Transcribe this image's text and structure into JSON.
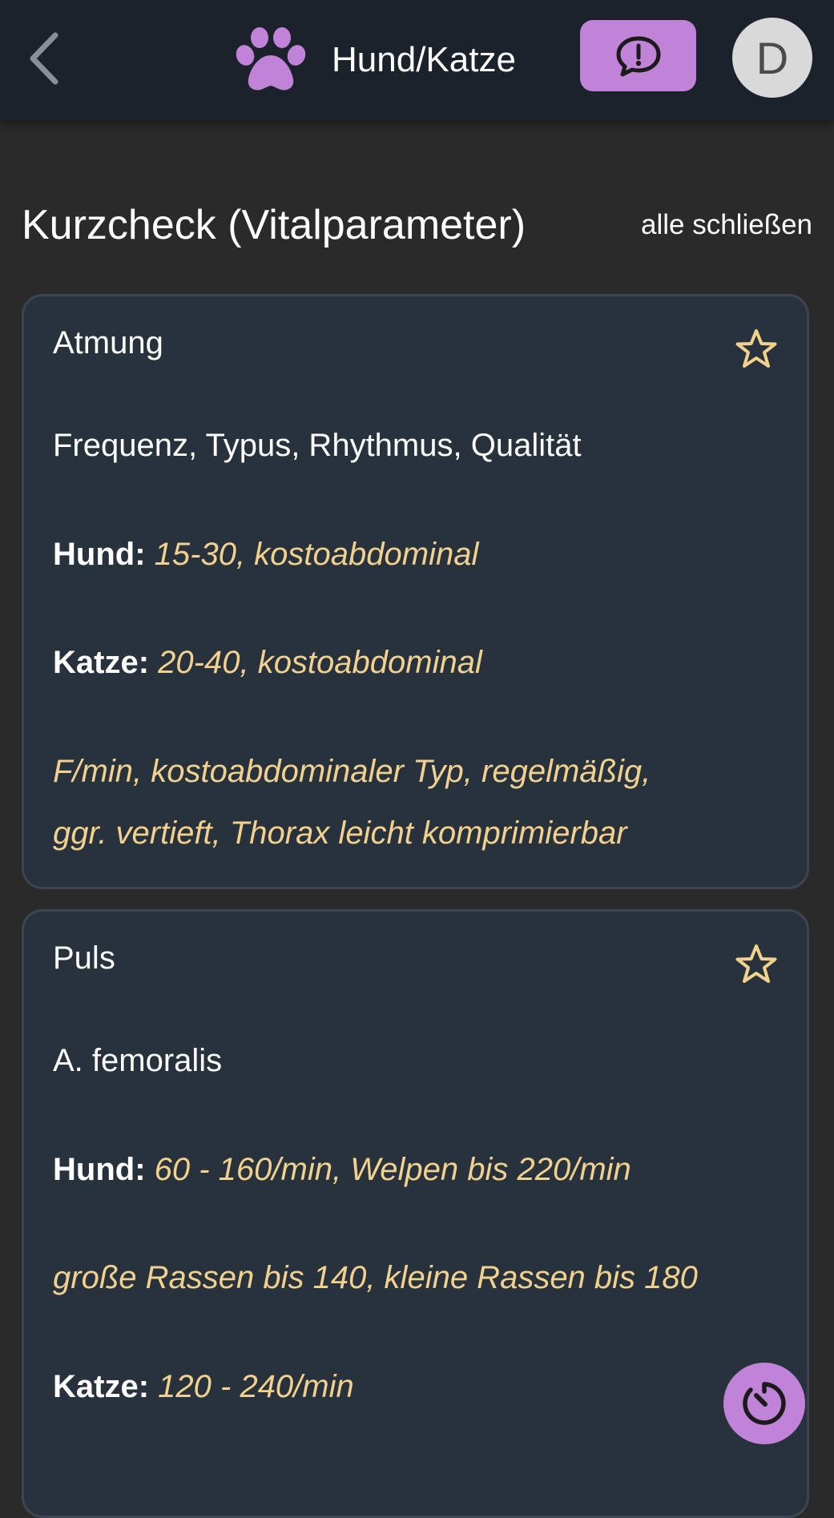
{
  "app_bar": {
    "title": "Hund/Katze",
    "back_icon": "chevron-left-icon",
    "logo_icon": "paw-icon",
    "feedback_icon": "speech-bubble-exclamation-icon",
    "avatar_initial": "D",
    "accent_color": "#c083d8"
  },
  "section": {
    "title": "Kurzcheck (Vitalparameter)",
    "close_all_label": "alle schließen"
  },
  "cards": [
    {
      "title": "Atmung",
      "favorite_icon": "star-outline-icon",
      "description": "Frequenz, Typus, Rhythmus, Qualität",
      "entries": [
        {
          "label": "Hund:",
          "value": "15-30, kostoabdominal"
        },
        {
          "label": "Katze:",
          "value": "20-40, kostoabdominal"
        }
      ],
      "note_lines": [
        "F/min, kostoabdominaler Typ, regelmäßig,",
        "ggr. vertieft, Thorax leicht komprimierbar"
      ]
    },
    {
      "title": "Puls",
      "favorite_icon": "star-outline-icon",
      "description": "A. femoralis",
      "entries": [
        {
          "label": "Hund:",
          "value": "60 - 160/min, Welpen bis 220/min"
        }
      ],
      "note_lines": [
        "große Rassen bis 140, kleine Rassen bis 180"
      ],
      "entries_after": [
        {
          "label": "Katze:",
          "value": "120 - 240/min"
        }
      ]
    }
  ],
  "fab": {
    "icon": "timer-icon"
  }
}
